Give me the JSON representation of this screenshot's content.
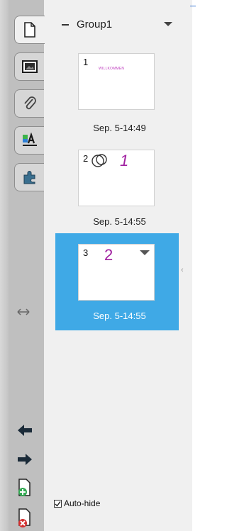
{
  "group": {
    "label": "Group1"
  },
  "pages": [
    {
      "number": "1",
      "date": "Sep. 5-14:49",
      "content_text": "WILLKOMMEN",
      "selected": false
    },
    {
      "number": "2",
      "date": "Sep. 5-14:55",
      "content_text": "1",
      "selected": false
    },
    {
      "number": "3",
      "date": "Sep. 5-14:55",
      "content_text": "2",
      "selected": true
    }
  ],
  "tabs": [
    {
      "icon": "page-sorter-icon",
      "active": true
    },
    {
      "icon": "gallery-icon",
      "active": false
    },
    {
      "icon": "attachments-icon",
      "active": false
    },
    {
      "icon": "properties-icon",
      "active": false
    },
    {
      "icon": "add-ons-icon",
      "active": false
    }
  ],
  "resize_handle": {
    "icon": "resize-arrows-icon"
  },
  "bottom_controls": [
    {
      "icon": "move-left-arrow-icon"
    },
    {
      "icon": "move-right-arrow-icon"
    },
    {
      "icon": "add-page-icon"
    },
    {
      "icon": "delete-page-icon"
    }
  ],
  "autohide": {
    "label": "Auto-hide",
    "checked": true
  },
  "colors": {
    "selection": "#3fa9e6",
    "ink": "#a020a0",
    "panel_bg": "#f0f0f0"
  }
}
